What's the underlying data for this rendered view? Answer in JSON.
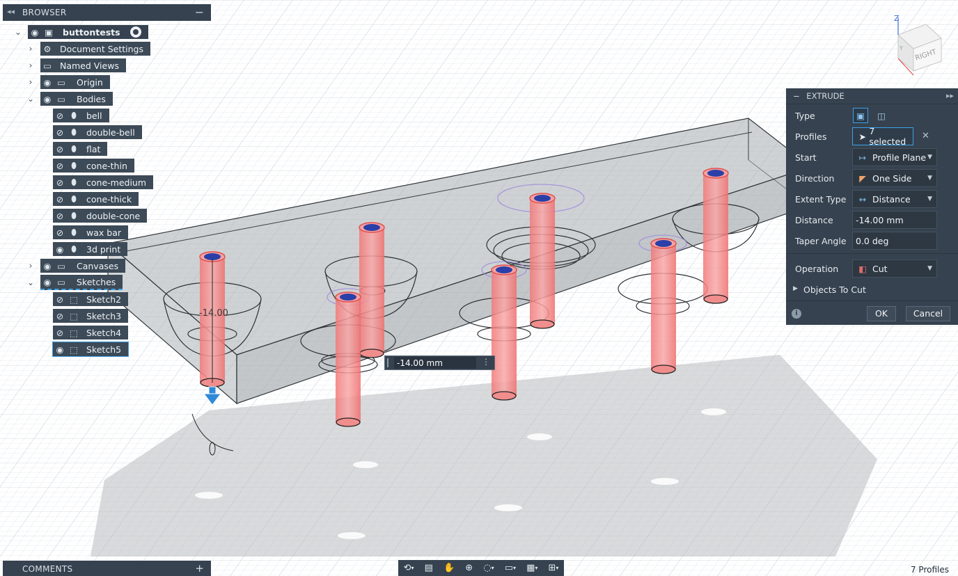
{
  "browser": {
    "title": "BROWSER",
    "root": "buttontests",
    "document_settings": "Document Settings",
    "named_views": "Named Views",
    "origin": "Origin",
    "bodies": "Bodies",
    "body_items": [
      "bell",
      "double-bell",
      "flat",
      "cone-thin",
      "cone-medium",
      "cone-thick",
      "double-cone",
      "wax bar",
      "3d print"
    ],
    "canvases": "Canvases",
    "sketches": "Sketches",
    "sketch_items": [
      "Sketch2",
      "Sketch3",
      "Sketch4",
      "Sketch5"
    ]
  },
  "extrude": {
    "title": "EXTRUDE",
    "type_label": "Type",
    "profiles_label": "Profiles",
    "profiles_value": "7 selected",
    "start_label": "Start",
    "start_value": "Profile Plane",
    "direction_label": "Direction",
    "direction_value": "One Side",
    "extent_label": "Extent Type",
    "extent_value": "Distance",
    "distance_label": "Distance",
    "distance_value": "-14.00 mm",
    "taper_label": "Taper Angle",
    "taper_value": "0.0 deg",
    "operation_label": "Operation",
    "operation_value": "Cut",
    "objects_to_cut": "Objects To Cut",
    "ok": "OK",
    "cancel": "Cancel"
  },
  "viewcube": {
    "face_label": "RIGHT",
    "axis_z": "Z",
    "axis_y": "Y"
  },
  "viewport": {
    "dimension_label": "-14.00",
    "dimension_input": "-14.00 mm"
  },
  "comments": {
    "title": "COMMENTS"
  },
  "status": {
    "profiles": "7 Profiles"
  },
  "colors": {
    "panel": "#36424f",
    "cut_red": "#f06a6a",
    "accent_blue": "#3ea1e6"
  }
}
